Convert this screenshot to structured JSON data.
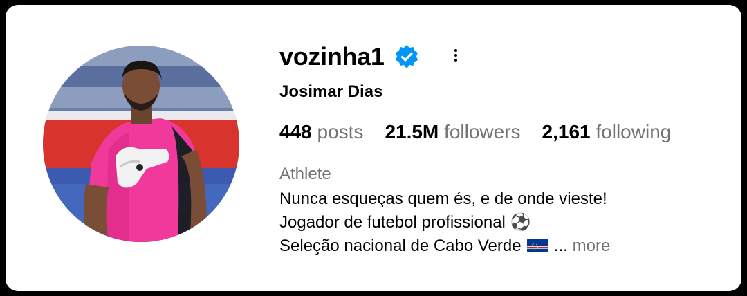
{
  "profile": {
    "username": "vozinha1",
    "full_name": "Josimar Dias",
    "verified_icon": "verified-badge-icon",
    "more_icon": "more-options-icon"
  },
  "stats": {
    "posts": {
      "value": "448",
      "label": "posts"
    },
    "followers": {
      "value": "21.5M",
      "label": "followers"
    },
    "following": {
      "value": "2,161",
      "label": "following"
    }
  },
  "bio": {
    "category": "Athlete",
    "line1": "Nunca esqueças quem és, e de onde vieste!",
    "line2": "Jogador de futebol profissional ⚽",
    "line3": "Seleção nacional de Cabo Verde",
    "ellipsis": " ... ",
    "more_label": "more"
  },
  "colors": {
    "verified_blue": "#0095f6",
    "secondary_text": "#737373",
    "jersey_pink": "#f0399a"
  }
}
